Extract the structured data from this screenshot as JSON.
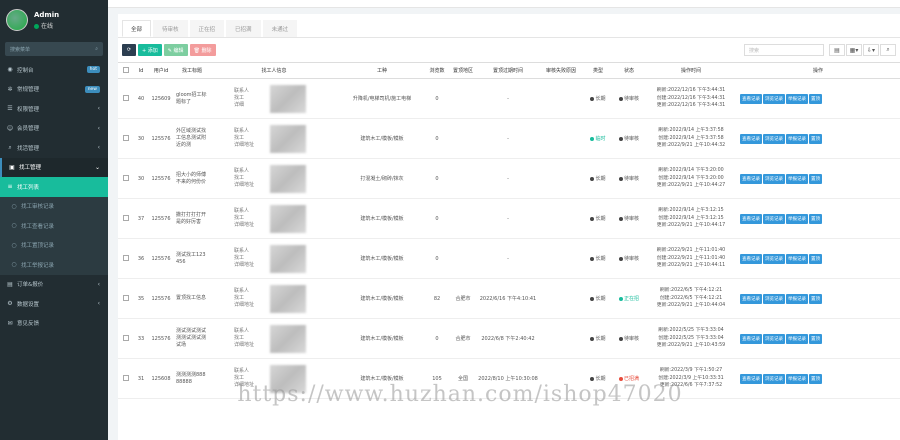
{
  "sidebar": {
    "user": {
      "name": "Admin",
      "status": "在线"
    },
    "search_placeholder": "搜索菜单",
    "items": [
      {
        "label": "控制台",
        "icon": "dashboard-icon",
        "badge": "hot"
      },
      {
        "label": "常规管理",
        "icon": "cogs-icon",
        "badge": "new"
      },
      {
        "label": "权限管理",
        "icon": "group-icon",
        "caret": "‹"
      },
      {
        "label": "会员管理",
        "icon": "user-icon",
        "caret": "‹"
      },
      {
        "label": "找活管理",
        "icon": "search-icon",
        "caret": "‹"
      },
      {
        "label": "找工管理",
        "icon": "briefcase-icon",
        "caret": "⌄",
        "state": "active-parent"
      },
      {
        "label": "找工列表",
        "icon": "list-icon",
        "state": "active"
      },
      {
        "label": "找工审核记录",
        "icon": "circle-icon",
        "state": "sub"
      },
      {
        "label": "找工查看记录",
        "icon": "circle-icon",
        "state": "sub"
      },
      {
        "label": "找工置顶记录",
        "icon": "circle-icon",
        "state": "sub"
      },
      {
        "label": "找工举报记录",
        "icon": "circle-icon",
        "state": "sub"
      },
      {
        "label": "订单&报价",
        "icon": "file-icon",
        "caret": "‹"
      },
      {
        "label": "数据设置",
        "icon": "cog-icon",
        "caret": "‹"
      },
      {
        "label": "意见反馈",
        "icon": "comment-icon"
      }
    ]
  },
  "tabs": [
    "全部",
    "待审核",
    "正在招",
    "已招满",
    "未通过"
  ],
  "toolbar": {
    "add": "+ 添加",
    "edit": "✎ 编辑",
    "delete": "🗑 删除",
    "search_placeholder": "搜索"
  },
  "table": {
    "headers": [
      "",
      "Id",
      "用户id",
      "找工标题",
      "找工人信息",
      "工种",
      "浏览数",
      "置顶地区",
      "置顶过期时间",
      "审核失败原因",
      "类型",
      "状态",
      "操作时间",
      "操作"
    ],
    "op_buttons": [
      "查看记录",
      "浏览记录",
      "举报记录",
      "置顶"
    ],
    "rows": [
      {
        "id": "40",
        "uid": "125609",
        "title": "gloom招工标题标了",
        "worker": [
          "联系人",
          "找工",
          "详细"
        ],
        "trade": "升降机/电梯司机/施工电梯",
        "views": "0",
        "area": "",
        "expire": "-",
        "reason": "",
        "type": "长期",
        "type_color": "dark",
        "status": "待审核",
        "status_color": "dark",
        "times": [
          "刷新:2022/12/16 下午3:44:31",
          "创建:2022/12/16 下午3:44:31",
          "更新:2022/12/16 下午3:44:31"
        ]
      },
      {
        "id": "30",
        "uid": "125576",
        "title": "外区域测试找工信息测试附近的测",
        "worker": [
          "联系人",
          "找工",
          "详细地址"
        ],
        "trade": "建筑木工/模板/模板",
        "views": "0",
        "area": "",
        "expire": "-",
        "reason": "",
        "type": "临时",
        "type_color": "green",
        "status": "待审核",
        "status_color": "dark",
        "times": [
          "刷新:2022/9/14 上午3:37:58",
          "创建:2022/9/14 上午3:37:58",
          "更新:2022/9/21 上午10:44:32"
        ]
      },
      {
        "id": "30",
        "uid": "125576",
        "title": "招大小的师傅不来的何份价",
        "worker": [
          "联系人",
          "找工",
          "详细地址"
        ],
        "trade": "打混凝土/砌砖/抹灰",
        "views": "0",
        "area": "",
        "expire": "-",
        "reason": "",
        "type": "长期",
        "type_color": "dark",
        "status": "待审核",
        "status_color": "dark",
        "times": [
          "刷新:2022/9/14 下午3:20:00",
          "创建:2022/9/14 下午3:20:00",
          "更新:2022/9/21 上午10:44:27"
        ]
      },
      {
        "id": "37",
        "uid": "125576",
        "title": "撒打打打打开是的好厉害",
        "worker": [
          "联系人",
          "找工",
          "详细地址"
        ],
        "trade": "建筑木工/模板/模板",
        "views": "0",
        "area": "",
        "expire": "-",
        "reason": "",
        "type": "长期",
        "type_color": "dark",
        "status": "待审核",
        "status_color": "dark",
        "times": [
          "刷新:2022/9/14 上午3:12:15",
          "创建:2022/9/14 上午3:12:15",
          "更新:2022/9/21 上午10:44:17"
        ]
      },
      {
        "id": "36",
        "uid": "125576",
        "title": "测试找工123456",
        "worker": [
          "联系人",
          "找工",
          "详细地址"
        ],
        "trade": "建筑木工/模板/模板",
        "views": "0",
        "area": "",
        "expire": "-",
        "reason": "",
        "type": "长期",
        "type_color": "dark",
        "status": "待审核",
        "status_color": "dark",
        "times": [
          "刷新:2022/9/21 上午11:01:40",
          "创建:2022/9/21 上午11:01:40",
          "更新:2022/9/21 上午10:44:11"
        ]
      },
      {
        "id": "35",
        "uid": "125576",
        "title": "置顶找工信息",
        "worker": [
          "联系人",
          "找工",
          "详细地址"
        ],
        "trade": "建筑木工/模板/模板",
        "views": "82",
        "area": "合肥市",
        "expire": "2022/6/16 下午4:10:41",
        "reason": "",
        "type": "长期",
        "type_color": "dark",
        "status": "正在招",
        "status_color": "green",
        "times": [
          "刷新:2022/6/5 下午4:12:21",
          "创建:2022/6/5 下午4:12:21",
          "更新:2022/9/21 上午10:44:04"
        ]
      },
      {
        "id": "33",
        "uid": "125576",
        "title": "测试测试测试测测试测试测试场",
        "worker": [
          "联系人",
          "找工",
          "详细地址"
        ],
        "trade": "建筑木工/模板/模板",
        "views": "0",
        "area": "合肥市",
        "expire": "2022/6/8 下午2:40:42",
        "reason": "",
        "type": "长期",
        "type_color": "dark",
        "status": "待审核",
        "status_color": "dark",
        "times": [
          "刷新:2022/5/25 下午3:33:04",
          "创建:2022/5/25 下午3:33:04",
          "更新:2022/9/21 上午10:43:59"
        ]
      },
      {
        "id": "31",
        "uid": "125608",
        "title": "测测测测88888888",
        "worker": [
          "联系人",
          "找工",
          "详细地址"
        ],
        "trade": "建筑木工/模板/模板",
        "views": "105",
        "area": "全国",
        "expire": "2022/8/10 上午10:30:08",
        "reason": "",
        "type": "长期",
        "type_color": "dark",
        "status": "已招满",
        "status_color": "red",
        "times": [
          "刷新:2022/3/9 下午1:50:27",
          "创建:2022/3/9 上午10:33:31",
          "更新:2022/6/6 下午7:37:52"
        ]
      }
    ]
  },
  "watermark": "https://www.huzhan.com/ishop47020"
}
